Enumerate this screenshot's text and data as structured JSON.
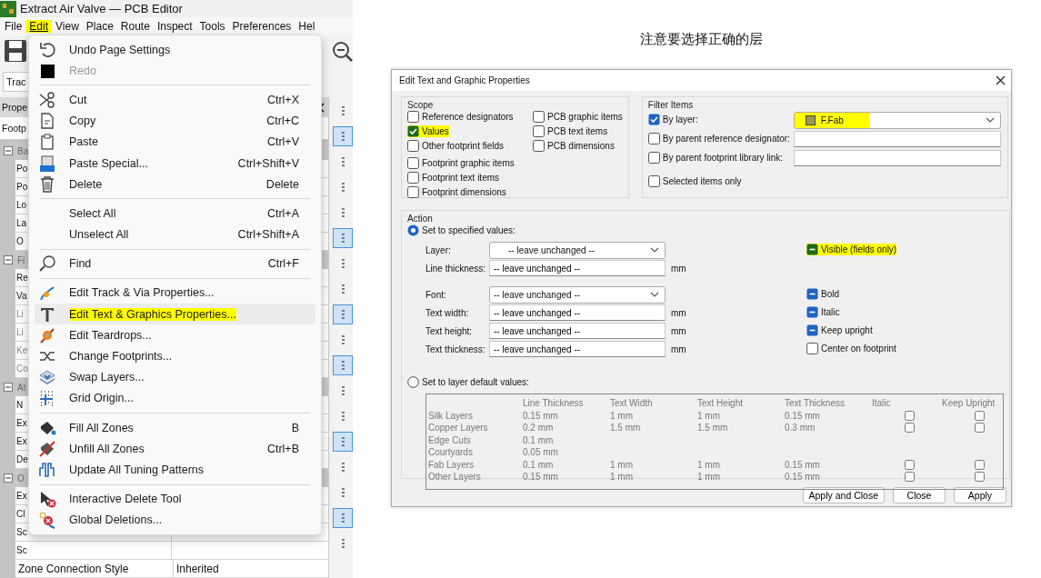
{
  "caption": "注意要选择正确的层",
  "editor": {
    "title": "Extract Air Valve — PCB Editor",
    "menubar": [
      {
        "label": "File",
        "selected": false,
        "highlighted": false
      },
      {
        "label": "Edit",
        "selected": true,
        "highlighted": true
      },
      {
        "label": "View",
        "selected": false,
        "highlighted": false
      },
      {
        "label": "Place",
        "selected": false,
        "highlighted": false
      },
      {
        "label": "Route",
        "selected": false,
        "highlighted": false
      },
      {
        "label": "Inspect",
        "selected": false,
        "highlighted": false
      },
      {
        "label": "Tools",
        "selected": false,
        "highlighted": false
      },
      {
        "label": "Preferences",
        "selected": false,
        "highlighted": false
      },
      {
        "label": "Hel",
        "selected": false,
        "highlighted": false
      }
    ],
    "selector": "Trac",
    "properties": {
      "title": "Prope",
      "subtitle": "Footp",
      "groups": [
        {
          "label": "Ba",
          "expanded": true,
          "rows": [
            {
              "name": "Po",
              "disabled": false
            },
            {
              "name": "Po",
              "disabled": false
            },
            {
              "name": "Lo",
              "disabled": false
            },
            {
              "name": "La",
              "disabled": false
            },
            {
              "name": "O",
              "disabled": false
            }
          ]
        },
        {
          "label": "Fi",
          "expanded": true,
          "rows": [
            {
              "name": "Re",
              "disabled": false
            },
            {
              "name": "Va",
              "disabled": false
            },
            {
              "name": "Li",
              "disabled": true
            },
            {
              "name": "Li",
              "disabled": true
            },
            {
              "name": "Ke",
              "disabled": true
            },
            {
              "name": "Co",
              "disabled": true
            }
          ]
        },
        {
          "label": "At",
          "expanded": true,
          "rows": [
            {
              "name": "N",
              "disabled": false
            },
            {
              "name": "Ex",
              "disabled": false
            },
            {
              "name": "Ex",
              "disabled": false
            },
            {
              "name": "De",
              "disabled": false
            }
          ]
        },
        {
          "label": "O",
          "expanded": true,
          "rows": [
            {
              "name": "Ex",
              "disabled": false
            },
            {
              "name": "Cl",
              "disabled": false
            },
            {
              "name": "Sc",
              "disabled": false
            },
            {
              "name": "Sc",
              "disabled": false
            },
            {
              "name": "Zone Connection Style",
              "value": "Inherited",
              "disabled": false
            }
          ]
        }
      ]
    },
    "tools": [
      {
        "selected": false
      },
      {
        "selected": true
      },
      {
        "selected": false
      },
      {
        "selected": false
      },
      {
        "selected": false
      },
      {
        "selected": true
      },
      {
        "selected": false
      },
      {
        "selected": false
      },
      {
        "selected": true
      },
      {
        "selected": false
      },
      {
        "selected": true
      },
      {
        "selected": false
      },
      {
        "selected": false
      },
      {
        "selected": true
      },
      {
        "selected": false
      },
      {
        "selected": false
      },
      {
        "selected": true
      },
      {
        "selected": false
      }
    ],
    "edit_menu": [
      {
        "kind": "item",
        "label": "Undo Page Settings",
        "disabled": false,
        "selected": false,
        "highlighted": false
      },
      {
        "kind": "item",
        "label": "Redo",
        "disabled": true,
        "selected": false,
        "highlighted": false
      },
      {
        "kind": "separator"
      },
      {
        "kind": "item",
        "label": "Cut",
        "shortcut": "Ctrl+X",
        "disabled": false,
        "selected": false,
        "highlighted": false
      },
      {
        "kind": "item",
        "label": "Copy",
        "shortcut": "Ctrl+C",
        "disabled": false,
        "selected": false,
        "highlighted": false
      },
      {
        "kind": "item",
        "label": "Paste",
        "shortcut": "Ctrl+V",
        "disabled": false,
        "selected": false,
        "highlighted": false
      },
      {
        "kind": "item",
        "label": "Paste Special...",
        "shortcut": "Ctrl+Shift+V",
        "disabled": false,
        "selected": false,
        "highlighted": false
      },
      {
        "kind": "item",
        "label": "Delete",
        "shortcut": "Delete",
        "disabled": false,
        "selected": false,
        "highlighted": false
      },
      {
        "kind": "separator"
      },
      {
        "kind": "item",
        "label": "Select All",
        "shortcut": "Ctrl+A",
        "disabled": false,
        "selected": false,
        "highlighted": false
      },
      {
        "kind": "item",
        "label": "Unselect All",
        "shortcut": "Ctrl+Shift+A",
        "disabled": false,
        "selected": false,
        "highlighted": false
      },
      {
        "kind": "separator"
      },
      {
        "kind": "item",
        "label": "Find",
        "shortcut": "Ctrl+F",
        "disabled": false,
        "selected": false,
        "highlighted": false
      },
      {
        "kind": "separator"
      },
      {
        "kind": "item",
        "label": "Edit Track & Via Properties...",
        "disabled": false,
        "selected": false,
        "highlighted": false
      },
      {
        "kind": "item",
        "label": "Edit Text & Graphics Properties...",
        "disabled": false,
        "selected": true,
        "highlighted": true
      },
      {
        "kind": "item",
        "label": "Edit Teardrops...",
        "disabled": false,
        "selected": false,
        "highlighted": false
      },
      {
        "kind": "item",
        "label": "Change Footprints...",
        "disabled": false,
        "selected": false,
        "highlighted": false
      },
      {
        "kind": "item",
        "label": "Swap Layers...",
        "disabled": false,
        "selected": false,
        "highlighted": false
      },
      {
        "kind": "item",
        "label": "Grid Origin...",
        "disabled": false,
        "selected": false,
        "highlighted": false
      },
      {
        "kind": "separator"
      },
      {
        "kind": "item",
        "label": "Fill All Zones",
        "shortcut": "B",
        "disabled": false,
        "selected": false,
        "highlighted": false
      },
      {
        "kind": "item",
        "label": "Unfill All Zones",
        "shortcut": "Ctrl+B",
        "disabled": false,
        "selected": false,
        "highlighted": false
      },
      {
        "kind": "item",
        "label": "Update All Tuning Patterns",
        "disabled": false,
        "selected": false,
        "highlighted": false
      },
      {
        "kind": "separator"
      },
      {
        "kind": "item",
        "label": "Interactive Delete Tool",
        "disabled": false,
        "selected": false,
        "highlighted": false
      },
      {
        "kind": "item",
        "label": "Global Deletions...",
        "disabled": false,
        "selected": false,
        "highlighted": false
      }
    ]
  },
  "dialog": {
    "title": "Edit Text and Graphic Properties",
    "scope": {
      "label": "Scope",
      "columns": [
        {
          "sections": [
            [
              {
                "label": "Reference designators",
                "checked": false,
                "highlighted": false
              },
              {
                "label": "Values",
                "checked": true,
                "highlighted": true
              },
              {
                "label": "Other footprint fields",
                "checked": false,
                "highlighted": false
              }
            ],
            [
              {
                "label": "Footprint graphic items",
                "checked": false,
                "highlighted": false
              },
              {
                "label": "Footprint text items",
                "checked": false,
                "highlighted": false
              },
              {
                "label": "Footprint dimensions",
                "checked": false,
                "highlighted": false
              }
            ]
          ]
        },
        {
          "sections": [
            [
              {
                "label": "PCB graphic items",
                "checked": false,
                "highlighted": false
              },
              {
                "label": "PCB text items",
                "checked": false,
                "highlighted": false
              },
              {
                "label": "PCB dimensions",
                "checked": false,
                "highlighted": false
              }
            ]
          ]
        }
      ]
    },
    "filter": {
      "label": "Filter Items",
      "rows": [
        {
          "kind": "dropdown",
          "label": "By layer:",
          "checked": true,
          "value": "F.Fab",
          "highlighted": true
        },
        {
          "kind": "field",
          "label": "By parent reference designator:",
          "checked": false
        },
        {
          "kind": "field",
          "label": "By parent footprint library link:",
          "checked": false
        },
        {
          "kind": "plain",
          "label": "Selected items only",
          "checked": false
        }
      ]
    },
    "action": {
      "label": "Action",
      "specified": {
        "label": "Set to specified values:",
        "selected": true
      },
      "field_groups": [
        [
          {
            "kind": "dropdown",
            "label": "Layer:",
            "value": "-- leave unchanged --",
            "toggle": {
              "label": "Visible  (fields only)",
              "indeterminate": true,
              "highlighted": true
            }
          },
          {
            "kind": "field",
            "label": "Line thickness:",
            "value": "-- leave unchanged --",
            "unit": "mm"
          }
        ],
        [
          {
            "kind": "dropdown",
            "label": "Font:",
            "value": "-- leave unchanged --",
            "toggle": {
              "label": "Bold",
              "indeterminate": true,
              "highlighted": false
            }
          },
          {
            "kind": "field",
            "label": "Text width:",
            "value": "-- leave unchanged --",
            "unit": "mm",
            "toggle": {
              "label": "Italic",
              "indeterminate": true,
              "highlighted": false
            }
          },
          {
            "kind": "field",
            "label": "Text height:",
            "value": "-- leave unchanged --",
            "unit": "mm",
            "toggle": {
              "label": "Keep upright",
              "indeterminate": true,
              "highlighted": false
            }
          },
          {
            "kind": "field",
            "label": "Text thickness:",
            "value": "-- leave unchanged --",
            "unit": "mm",
            "toggle": {
              "label": "Center on footprint",
              "checked": false,
              "indeterminate": false,
              "highlighted": false
            }
          }
        ]
      ],
      "defaults": {
        "label": "Set to layer default values:",
        "selected": false
      },
      "layer_defaults": {
        "disabled": true,
        "columns": [
          "Line Thickness",
          "Text Width",
          "Text Height",
          "Text Thickness",
          "Italic",
          "Keep Upright"
        ],
        "rows": [
          {
            "layer": "Silk Layers",
            "values": [
              "0.15 mm",
              "1 mm",
              "1 mm",
              "0.15 mm"
            ],
            "italic": false,
            "keep_upright": false
          },
          {
            "layer": "Copper Layers",
            "values": [
              "0.2 mm",
              "1.5 mm",
              "1.5 mm",
              "0.3 mm"
            ],
            "italic": false,
            "keep_upright": false
          },
          {
            "layer": "Edge Cuts",
            "values": [
              "0.1 mm"
            ]
          },
          {
            "layer": "Courtyards",
            "values": [
              "0.05 mm"
            ]
          },
          {
            "layer": "Fab Layers",
            "values": [
              "0.1 mm",
              "1 mm",
              "1 mm",
              "0.15 mm"
            ],
            "italic": false,
            "keep_upright": false
          },
          {
            "layer": "Other Layers",
            "values": [
              "0.15 mm",
              "1 mm",
              "1 mm",
              "0.15 mm"
            ],
            "italic": false,
            "keep_upright": false
          }
        ]
      }
    },
    "buttons": [
      "Apply and Close",
      "Close",
      "Apply"
    ]
  }
}
